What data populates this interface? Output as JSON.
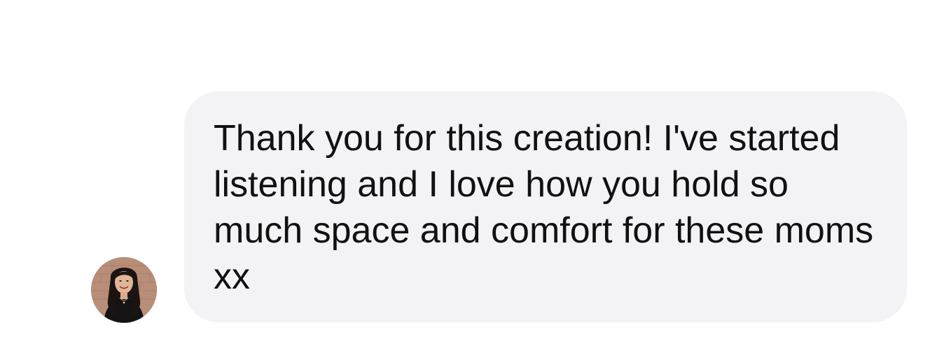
{
  "message": {
    "text": "Thank you for this creation! I've started listening and I love how you hold so much space and comfort for these moms xx",
    "bubble_color": "#f3f3f5",
    "text_color": "#111111"
  },
  "avatar": {
    "icon": "user-avatar-photo"
  }
}
